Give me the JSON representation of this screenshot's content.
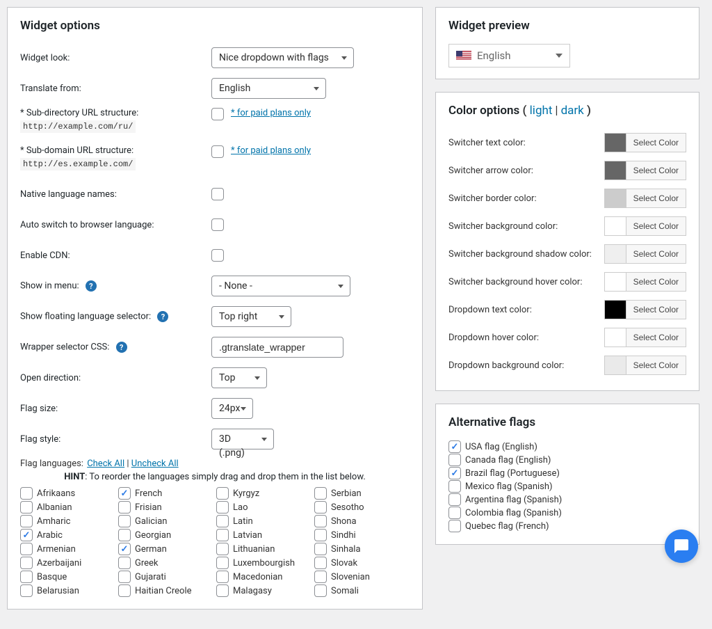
{
  "widget_options": {
    "title": "Widget options",
    "rows": {
      "widget_look": {
        "label": "Widget look:",
        "value": "Nice dropdown with flags"
      },
      "translate_from": {
        "label": "Translate from:",
        "value": "English"
      },
      "sub_dir": {
        "label": "* Sub-directory URL structure:",
        "code": "http://example.com/ru/",
        "link": "* for paid plans only"
      },
      "sub_domain": {
        "label": "* Sub-domain URL structure:",
        "code": "http://es.example.com/",
        "link": "* for paid plans only"
      },
      "native_names": {
        "label": "Native language names:"
      },
      "auto_switch": {
        "label": "Auto switch to browser language:"
      },
      "enable_cdn": {
        "label": "Enable CDN:"
      },
      "show_in_menu": {
        "label": "Show in menu:",
        "value": "- None -"
      },
      "floating_selector": {
        "label": "Show floating language selector:",
        "value": "Top right"
      },
      "wrapper_css": {
        "label": "Wrapper selector CSS:",
        "value": ".gtranslate_wrapper"
      },
      "open_direction": {
        "label": "Open direction:",
        "value": "Top"
      },
      "flag_size": {
        "label": "Flag size:",
        "value": "24px"
      },
      "flag_style": {
        "label": "Flag style:",
        "value": "3D (.png)"
      }
    },
    "flag_languages_label": "Flag languages:",
    "check_all": "Check All",
    "uncheck_all": "Uncheck All",
    "hint_bold": "HINT",
    "hint_rest": ": To reorder the languages simply drag and drop them in the list below.",
    "langs": [
      {
        "n": "Afrikaans",
        "c": false
      },
      {
        "n": "French",
        "c": true
      },
      {
        "n": "Kyrgyz",
        "c": false
      },
      {
        "n": "Serbian",
        "c": false
      },
      {
        "n": "Albanian",
        "c": false
      },
      {
        "n": "Frisian",
        "c": false
      },
      {
        "n": "Lao",
        "c": false
      },
      {
        "n": "Sesotho",
        "c": false
      },
      {
        "n": "Amharic",
        "c": false
      },
      {
        "n": "Galician",
        "c": false
      },
      {
        "n": "Latin",
        "c": false
      },
      {
        "n": "Shona",
        "c": false
      },
      {
        "n": "Arabic",
        "c": true
      },
      {
        "n": "Georgian",
        "c": false
      },
      {
        "n": "Latvian",
        "c": false
      },
      {
        "n": "Sindhi",
        "c": false
      },
      {
        "n": "Armenian",
        "c": false
      },
      {
        "n": "German",
        "c": true
      },
      {
        "n": "Lithuanian",
        "c": false
      },
      {
        "n": "Sinhala",
        "c": false
      },
      {
        "n": "Azerbaijani",
        "c": false
      },
      {
        "n": "Greek",
        "c": false
      },
      {
        "n": "Luxembourgish",
        "c": false
      },
      {
        "n": "Slovak",
        "c": false
      },
      {
        "n": "Basque",
        "c": false
      },
      {
        "n": "Gujarati",
        "c": false
      },
      {
        "n": "Macedonian",
        "c": false
      },
      {
        "n": "Slovenian",
        "c": false
      },
      {
        "n": "Belarusian",
        "c": false
      },
      {
        "n": "Haitian Creole",
        "c": false
      },
      {
        "n": "Malagasy",
        "c": false
      },
      {
        "n": "Somali",
        "c": false
      }
    ]
  },
  "widget_preview": {
    "title": "Widget preview",
    "language": "English"
  },
  "color_options": {
    "title": "Color options",
    "light": "light",
    "dark": "dark",
    "rows": [
      {
        "label": "Switcher text color:",
        "swatch": "#666666"
      },
      {
        "label": "Switcher arrow color:",
        "swatch": "#666666"
      },
      {
        "label": "Switcher border color:",
        "swatch": "#cccccc"
      },
      {
        "label": "Switcher background color:",
        "swatch": "#ffffff"
      },
      {
        "label": "Switcher background shadow color:",
        "swatch": "#efefef"
      },
      {
        "label": "Switcher background hover color:",
        "swatch": "#ffffff"
      },
      {
        "label": "Dropdown text color:",
        "swatch": "#000000"
      },
      {
        "label": "Dropdown hover color:",
        "swatch": "#ffffff"
      },
      {
        "label": "Dropdown background color:",
        "swatch": "#eaeaea"
      }
    ],
    "select_color_label": "Select Color"
  },
  "alt_flags": {
    "title": "Alternative flags",
    "items": [
      {
        "label": "USA flag (English)",
        "checked": true
      },
      {
        "label": "Canada flag (English)",
        "checked": false
      },
      {
        "label": "Brazil flag (Portuguese)",
        "checked": true
      },
      {
        "label": "Mexico flag (Spanish)",
        "checked": false
      },
      {
        "label": "Argentina flag (Spanish)",
        "checked": false
      },
      {
        "label": "Colombia flag (Spanish)",
        "checked": false
      },
      {
        "label": "Quebec flag (French)",
        "checked": false
      }
    ]
  }
}
